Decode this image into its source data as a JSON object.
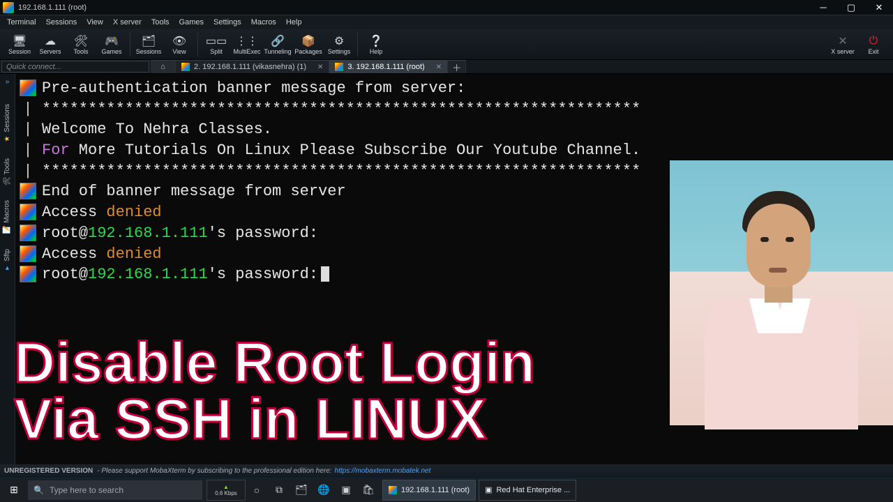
{
  "window": {
    "title": "192.168.1.111 (root)"
  },
  "menu": [
    "Terminal",
    "Sessions",
    "View",
    "X server",
    "Tools",
    "Games",
    "Settings",
    "Macros",
    "Help"
  ],
  "toolbar": [
    {
      "label": "Session",
      "icon": "🖥"
    },
    {
      "label": "Servers",
      "icon": "☁"
    },
    {
      "label": "Tools",
      "icon": "🛠"
    },
    {
      "label": "Games",
      "icon": "🎮"
    },
    {
      "label": "Sessions",
      "icon": "🗂"
    },
    {
      "label": "View",
      "icon": "👁"
    },
    {
      "label": "Split",
      "icon": "▭▭"
    },
    {
      "label": "MultiExec",
      "icon": "⋮⋮"
    },
    {
      "label": "Tunneling",
      "icon": "🔗"
    },
    {
      "label": "Packages",
      "icon": "📦"
    },
    {
      "label": "Settings",
      "icon": "⚙"
    },
    {
      "label": "Help",
      "icon": "❔"
    }
  ],
  "toolbar_right": [
    {
      "label": "X server",
      "icon": "✕"
    },
    {
      "label": "Exit",
      "icon": "⏻"
    }
  ],
  "quick_connect_placeholder": "Quick connect...",
  "tabs": [
    {
      "label": "2. 192.168.1.111 (vikasnehra) (1)",
      "active": false
    },
    {
      "label": "3. 192.168.1.111 (root)",
      "active": true
    }
  ],
  "sidebar": [
    {
      "label": "Sessions",
      "icon": "★"
    },
    {
      "label": "Tools",
      "icon": "🛠"
    },
    {
      "label": "Macros",
      "icon": "📝"
    },
    {
      "label": "Sftp",
      "icon": "▸"
    }
  ],
  "terminal": {
    "ip": "192.168.1.111",
    "l1": "Pre-authentication banner message from server:",
    "stars": "*****************************************************************",
    "l2": "Welcome To Nehra Classes.",
    "l3a": "For",
    "l3b": " More Tutorials On Linux Please Subscribe Our Youtube Channel.",
    "l4": "End of banner message from server",
    "access": "Access ",
    "denied": "denied",
    "rootat": "root@",
    "pwd": "'s password:"
  },
  "status": {
    "bold": "UNREGISTERED VERSION",
    "text": " -  Please support MobaXterm by subscribing to the professional edition here:",
    "link": "https://mobaxterm.mobatek.net"
  },
  "taskbar": {
    "search_placeholder": "Type here to search",
    "net": "0.6 Kbps",
    "apps": [
      {
        "label": "192.168.1.111 (root)",
        "active": true,
        "icon": "◧"
      },
      {
        "label": "Red Hat Enterprise ...",
        "active": false,
        "icon": "▣"
      }
    ]
  },
  "overlay": {
    "line1": "Disable Root Login",
    "line2": "Via SSH in LINUX"
  }
}
